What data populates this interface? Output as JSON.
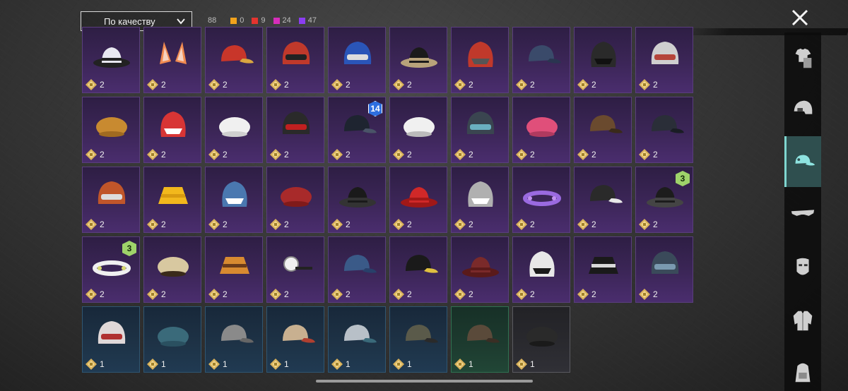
{
  "filter": {
    "sort_label": "По качеству"
  },
  "counts": {
    "total": "88",
    "by_rarity": [
      {
        "color": "#f2a21c",
        "value": "0"
      },
      {
        "color": "#e4342f",
        "value": "9"
      },
      {
        "color": "#d62dbb",
        "value": "24"
      },
      {
        "color": "#8b3df2",
        "value": "47"
      }
    ]
  },
  "sidebar": {
    "categories": [
      {
        "name": "outfit",
        "icon": "outfit-icon"
      },
      {
        "name": "helmet",
        "icon": "helmet-icon"
      },
      {
        "name": "headwear",
        "icon": "cap-icon",
        "active": true
      },
      {
        "name": "eyewear",
        "icon": "glasses-icon"
      },
      {
        "name": "mask",
        "icon": "mask-icon"
      },
      {
        "name": "jacket",
        "icon": "jacket-icon"
      },
      {
        "name": "backpack",
        "icon": "backpack-icon"
      }
    ]
  },
  "inventory": {
    "items": [
      {
        "icon": "wide-brim-hat-icon",
        "qty": "2",
        "rarity": "epic"
      },
      {
        "icon": "cat-ears-icon",
        "qty": "2",
        "rarity": "epic"
      },
      {
        "icon": "red-gold-cap-icon",
        "qty": "2",
        "rarity": "epic"
      },
      {
        "icon": "football-helmet-red-icon",
        "qty": "2",
        "rarity": "epic"
      },
      {
        "icon": "blue-batting-helmet-icon",
        "qty": "2",
        "rarity": "epic"
      },
      {
        "icon": "halo-hat-icon",
        "qty": "2",
        "rarity": "epic"
      },
      {
        "icon": "tribal-mask-icon",
        "qty": "2",
        "rarity": "epic"
      },
      {
        "icon": "navy-cap-icon",
        "qty": "2",
        "rarity": "epic"
      },
      {
        "icon": "gas-mask-helmet-icon",
        "qty": "2",
        "rarity": "epic"
      },
      {
        "icon": "goggle-helmet-icon",
        "qty": "2",
        "rarity": "epic"
      },
      {
        "icon": "orange-beanie-icon",
        "qty": "2",
        "rarity": "epic"
      },
      {
        "icon": "bandana-hat-icon",
        "qty": "2",
        "rarity": "epic"
      },
      {
        "icon": "turban-icon",
        "qty": "2",
        "rarity": "epic"
      },
      {
        "icon": "black-helmet-icon",
        "qty": "2",
        "rarity": "epic"
      },
      {
        "icon": "police-cap-icon",
        "qty": "2",
        "rarity": "epic",
        "badge": "14",
        "badge_style": "blue"
      },
      {
        "icon": "white-cloth-hat-icon",
        "qty": "2",
        "rarity": "epic"
      },
      {
        "icon": "visor-helmet-icon",
        "qty": "2",
        "rarity": "epic"
      },
      {
        "icon": "pink-beret-icon",
        "qty": "2",
        "rarity": "epic"
      },
      {
        "icon": "aviator-cap-icon",
        "qty": "2",
        "rarity": "epic"
      },
      {
        "icon": "dark-cap-icon",
        "qty": "2",
        "rarity": "epic"
      },
      {
        "icon": "orange-football-helmet-icon",
        "qty": "2",
        "rarity": "epic"
      },
      {
        "icon": "yellow-bucket-hat-icon",
        "qty": "2",
        "rarity": "epic"
      },
      {
        "icon": "shark-hat-icon",
        "qty": "2",
        "rarity": "epic"
      },
      {
        "icon": "red-beret-icon",
        "qty": "2",
        "rarity": "epic"
      },
      {
        "icon": "black-fedora-icon",
        "qty": "2",
        "rarity": "epic"
      },
      {
        "icon": "red-fedora-icon",
        "qty": "2",
        "rarity": "epic"
      },
      {
        "icon": "grey-shark-hat-icon",
        "qty": "2",
        "rarity": "epic"
      },
      {
        "icon": "flower-crown-icon",
        "qty": "2",
        "rarity": "epic"
      },
      {
        "icon": "officer-cap-icon",
        "qty": "2",
        "rarity": "epic"
      },
      {
        "icon": "black-trilby-icon",
        "qty": "2",
        "rarity": "epic",
        "badge": "3",
        "badge_style": "green"
      },
      {
        "icon": "white-flower-crown-icon",
        "qty": "2",
        "rarity": "epic",
        "badge": "3",
        "badge_style": "green"
      },
      {
        "icon": "knit-bobble-hat-icon",
        "qty": "2",
        "rarity": "epic"
      },
      {
        "icon": "burger-hat-icon",
        "qty": "2",
        "rarity": "epic"
      },
      {
        "icon": "head-mirror-icon",
        "qty": "2",
        "rarity": "epic"
      },
      {
        "icon": "navy-garrison-cap-icon",
        "qty": "2",
        "rarity": "epic"
      },
      {
        "icon": "black-logo-cap-icon",
        "qty": "2",
        "rarity": "epic"
      },
      {
        "icon": "brown-cowboy-hat-icon",
        "qty": "2",
        "rarity": "epic"
      },
      {
        "icon": "checkered-bandana-icon",
        "qty": "2",
        "rarity": "epic"
      },
      {
        "icon": "black-bucket-hat-icon",
        "qty": "2",
        "rarity": "epic"
      },
      {
        "icon": "pilot-helmet-icon",
        "qty": "2",
        "rarity": "epic"
      },
      {
        "icon": "white-red-helmet-icon",
        "qty": "1",
        "rarity": "blue"
      },
      {
        "icon": "teal-beret-icon",
        "qty": "1",
        "rarity": "blue"
      },
      {
        "icon": "grey-flat-cap-icon",
        "qty": "1",
        "rarity": "blue"
      },
      {
        "icon": "tan-baseball-cap-icon",
        "qty": "1",
        "rarity": "blue"
      },
      {
        "icon": "grey-baseball-cap-icon",
        "qty": "1",
        "rarity": "blue"
      },
      {
        "icon": "camo-headset-cap-icon",
        "qty": "1",
        "rarity": "blue"
      },
      {
        "icon": "military-cap-icon",
        "qty": "1",
        "rarity": "green"
      },
      {
        "icon": "black-beanie-icon",
        "qty": "1",
        "rarity": "gray"
      }
    ]
  }
}
